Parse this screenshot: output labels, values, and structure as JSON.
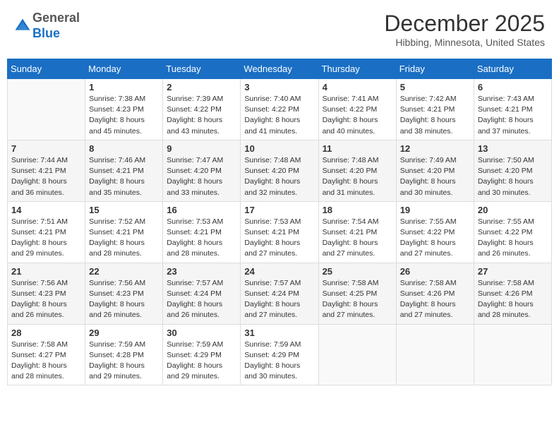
{
  "logo": {
    "general": "General",
    "blue": "Blue"
  },
  "header": {
    "month": "December 2025",
    "location": "Hibbing, Minnesota, United States"
  },
  "days_of_week": [
    "Sunday",
    "Monday",
    "Tuesday",
    "Wednesday",
    "Thursday",
    "Friday",
    "Saturday"
  ],
  "weeks": [
    [
      {
        "day": "",
        "info": ""
      },
      {
        "day": "1",
        "info": "Sunrise: 7:38 AM\nSunset: 4:23 PM\nDaylight: 8 hours\nand 45 minutes."
      },
      {
        "day": "2",
        "info": "Sunrise: 7:39 AM\nSunset: 4:22 PM\nDaylight: 8 hours\nand 43 minutes."
      },
      {
        "day": "3",
        "info": "Sunrise: 7:40 AM\nSunset: 4:22 PM\nDaylight: 8 hours\nand 41 minutes."
      },
      {
        "day": "4",
        "info": "Sunrise: 7:41 AM\nSunset: 4:22 PM\nDaylight: 8 hours\nand 40 minutes."
      },
      {
        "day": "5",
        "info": "Sunrise: 7:42 AM\nSunset: 4:21 PM\nDaylight: 8 hours\nand 38 minutes."
      },
      {
        "day": "6",
        "info": "Sunrise: 7:43 AM\nSunset: 4:21 PM\nDaylight: 8 hours\nand 37 minutes."
      }
    ],
    [
      {
        "day": "7",
        "info": "Sunrise: 7:44 AM\nSunset: 4:21 PM\nDaylight: 8 hours\nand 36 minutes."
      },
      {
        "day": "8",
        "info": "Sunrise: 7:46 AM\nSunset: 4:21 PM\nDaylight: 8 hours\nand 35 minutes."
      },
      {
        "day": "9",
        "info": "Sunrise: 7:47 AM\nSunset: 4:20 PM\nDaylight: 8 hours\nand 33 minutes."
      },
      {
        "day": "10",
        "info": "Sunrise: 7:48 AM\nSunset: 4:20 PM\nDaylight: 8 hours\nand 32 minutes."
      },
      {
        "day": "11",
        "info": "Sunrise: 7:48 AM\nSunset: 4:20 PM\nDaylight: 8 hours\nand 31 minutes."
      },
      {
        "day": "12",
        "info": "Sunrise: 7:49 AM\nSunset: 4:20 PM\nDaylight: 8 hours\nand 30 minutes."
      },
      {
        "day": "13",
        "info": "Sunrise: 7:50 AM\nSunset: 4:20 PM\nDaylight: 8 hours\nand 30 minutes."
      }
    ],
    [
      {
        "day": "14",
        "info": "Sunrise: 7:51 AM\nSunset: 4:21 PM\nDaylight: 8 hours\nand 29 minutes."
      },
      {
        "day": "15",
        "info": "Sunrise: 7:52 AM\nSunset: 4:21 PM\nDaylight: 8 hours\nand 28 minutes."
      },
      {
        "day": "16",
        "info": "Sunrise: 7:53 AM\nSunset: 4:21 PM\nDaylight: 8 hours\nand 28 minutes."
      },
      {
        "day": "17",
        "info": "Sunrise: 7:53 AM\nSunset: 4:21 PM\nDaylight: 8 hours\nand 27 minutes."
      },
      {
        "day": "18",
        "info": "Sunrise: 7:54 AM\nSunset: 4:21 PM\nDaylight: 8 hours\nand 27 minutes."
      },
      {
        "day": "19",
        "info": "Sunrise: 7:55 AM\nSunset: 4:22 PM\nDaylight: 8 hours\nand 27 minutes."
      },
      {
        "day": "20",
        "info": "Sunrise: 7:55 AM\nSunset: 4:22 PM\nDaylight: 8 hours\nand 26 minutes."
      }
    ],
    [
      {
        "day": "21",
        "info": "Sunrise: 7:56 AM\nSunset: 4:23 PM\nDaylight: 8 hours\nand 26 minutes."
      },
      {
        "day": "22",
        "info": "Sunrise: 7:56 AM\nSunset: 4:23 PM\nDaylight: 8 hours\nand 26 minutes."
      },
      {
        "day": "23",
        "info": "Sunrise: 7:57 AM\nSunset: 4:24 PM\nDaylight: 8 hours\nand 26 minutes."
      },
      {
        "day": "24",
        "info": "Sunrise: 7:57 AM\nSunset: 4:24 PM\nDaylight: 8 hours\nand 27 minutes."
      },
      {
        "day": "25",
        "info": "Sunrise: 7:58 AM\nSunset: 4:25 PM\nDaylight: 8 hours\nand 27 minutes."
      },
      {
        "day": "26",
        "info": "Sunrise: 7:58 AM\nSunset: 4:26 PM\nDaylight: 8 hours\nand 27 minutes."
      },
      {
        "day": "27",
        "info": "Sunrise: 7:58 AM\nSunset: 4:26 PM\nDaylight: 8 hours\nand 28 minutes."
      }
    ],
    [
      {
        "day": "28",
        "info": "Sunrise: 7:58 AM\nSunset: 4:27 PM\nDaylight: 8 hours\nand 28 minutes."
      },
      {
        "day": "29",
        "info": "Sunrise: 7:59 AM\nSunset: 4:28 PM\nDaylight: 8 hours\nand 29 minutes."
      },
      {
        "day": "30",
        "info": "Sunrise: 7:59 AM\nSunset: 4:29 PM\nDaylight: 8 hours\nand 29 minutes."
      },
      {
        "day": "31",
        "info": "Sunrise: 7:59 AM\nSunset: 4:29 PM\nDaylight: 8 hours\nand 30 minutes."
      },
      {
        "day": "",
        "info": ""
      },
      {
        "day": "",
        "info": ""
      },
      {
        "day": "",
        "info": ""
      }
    ]
  ]
}
